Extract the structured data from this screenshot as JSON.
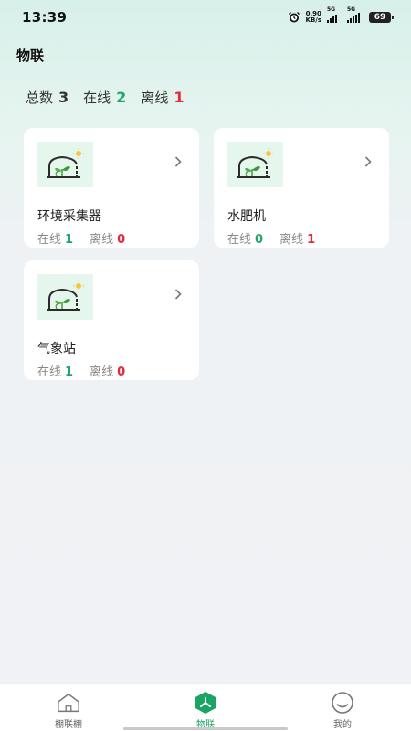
{
  "status_bar": {
    "time": "13:39",
    "net_speed_value": "0.90",
    "net_speed_unit": "KB/s",
    "signal1_label": "5G",
    "signal2_label": "5G",
    "battery": "69",
    "icons": [
      "alarm-icon",
      "signal-icon",
      "battery-icon"
    ]
  },
  "header": {
    "title": "物联"
  },
  "summary": {
    "total_label": "总数",
    "total_value": "3",
    "online_label": "在线",
    "online_value": "2",
    "offline_label": "离线",
    "offline_value": "1"
  },
  "devices": [
    {
      "name": "环境采集器",
      "online_label": "在线",
      "online": "1",
      "offline_label": "离线",
      "offline": "0"
    },
    {
      "name": "水肥机",
      "online_label": "在线",
      "online": "0",
      "offline_label": "离线",
      "offline": "1"
    },
    {
      "name": "气象站",
      "online_label": "在线",
      "online": "1",
      "offline_label": "离线",
      "offline": "0"
    }
  ],
  "nav": {
    "items": [
      {
        "label": "棚联棚",
        "icon": "house-icon"
      },
      {
        "label": "物联",
        "icon": "iot-hub-icon"
      },
      {
        "label": "我的",
        "icon": "smile-icon"
      }
    ],
    "active_index": 1
  },
  "colors": {
    "online": "#1fa86a",
    "offline": "#e02b3c",
    "accent": "#1aa564",
    "thumb_bg": "#e5f6ec"
  }
}
